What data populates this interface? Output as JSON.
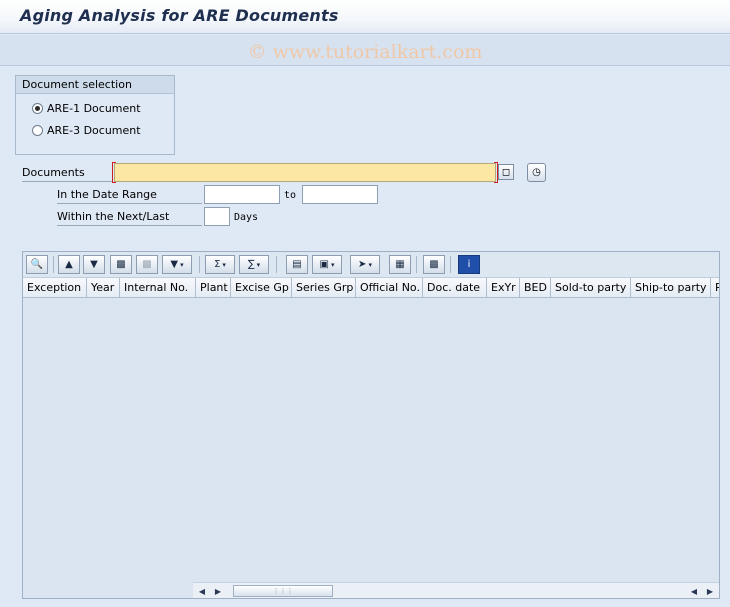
{
  "title": "Aging Analysis for ARE Documents",
  "watermark": "© www.tutorialkart.com",
  "selection": {
    "group_title": "Document selection",
    "options": [
      {
        "label": "ARE-1 Document",
        "selected": true
      },
      {
        "label": "ARE-3 Document",
        "selected": false
      }
    ]
  },
  "form": {
    "documents_label": "Documents",
    "documents_value": "",
    "date_range_label": "In the Date Range",
    "date_from": "",
    "to_label": "to",
    "date_to": "",
    "next_last_label": "Within the Next/Last",
    "days_value": "",
    "days_label": "Days"
  },
  "toolbar": {
    "icons": [
      "details-icon",
      "print-icon",
      "filter-icon",
      "find-icon",
      "find-next-icon",
      "set-filter-icon",
      "sum-icon",
      "subtotal-icon",
      "print-preview-icon",
      "export-icon",
      "save-local-icon",
      "layout-grid-icon",
      "chart-icon",
      "info-icon"
    ]
  },
  "table": {
    "columns": [
      "Exception",
      "Year",
      "Internal No.",
      "Plant",
      "Excise Gp",
      "Series Grp",
      "Official No.",
      "Doc. date",
      "ExYr",
      "BED",
      "Sold-to party",
      "Ship-to party",
      "R"
    ],
    "rows": []
  },
  "colors": {
    "background": "#dfe9f5",
    "required_field": "#fce8a4",
    "title_text": "#1e2f4f"
  }
}
